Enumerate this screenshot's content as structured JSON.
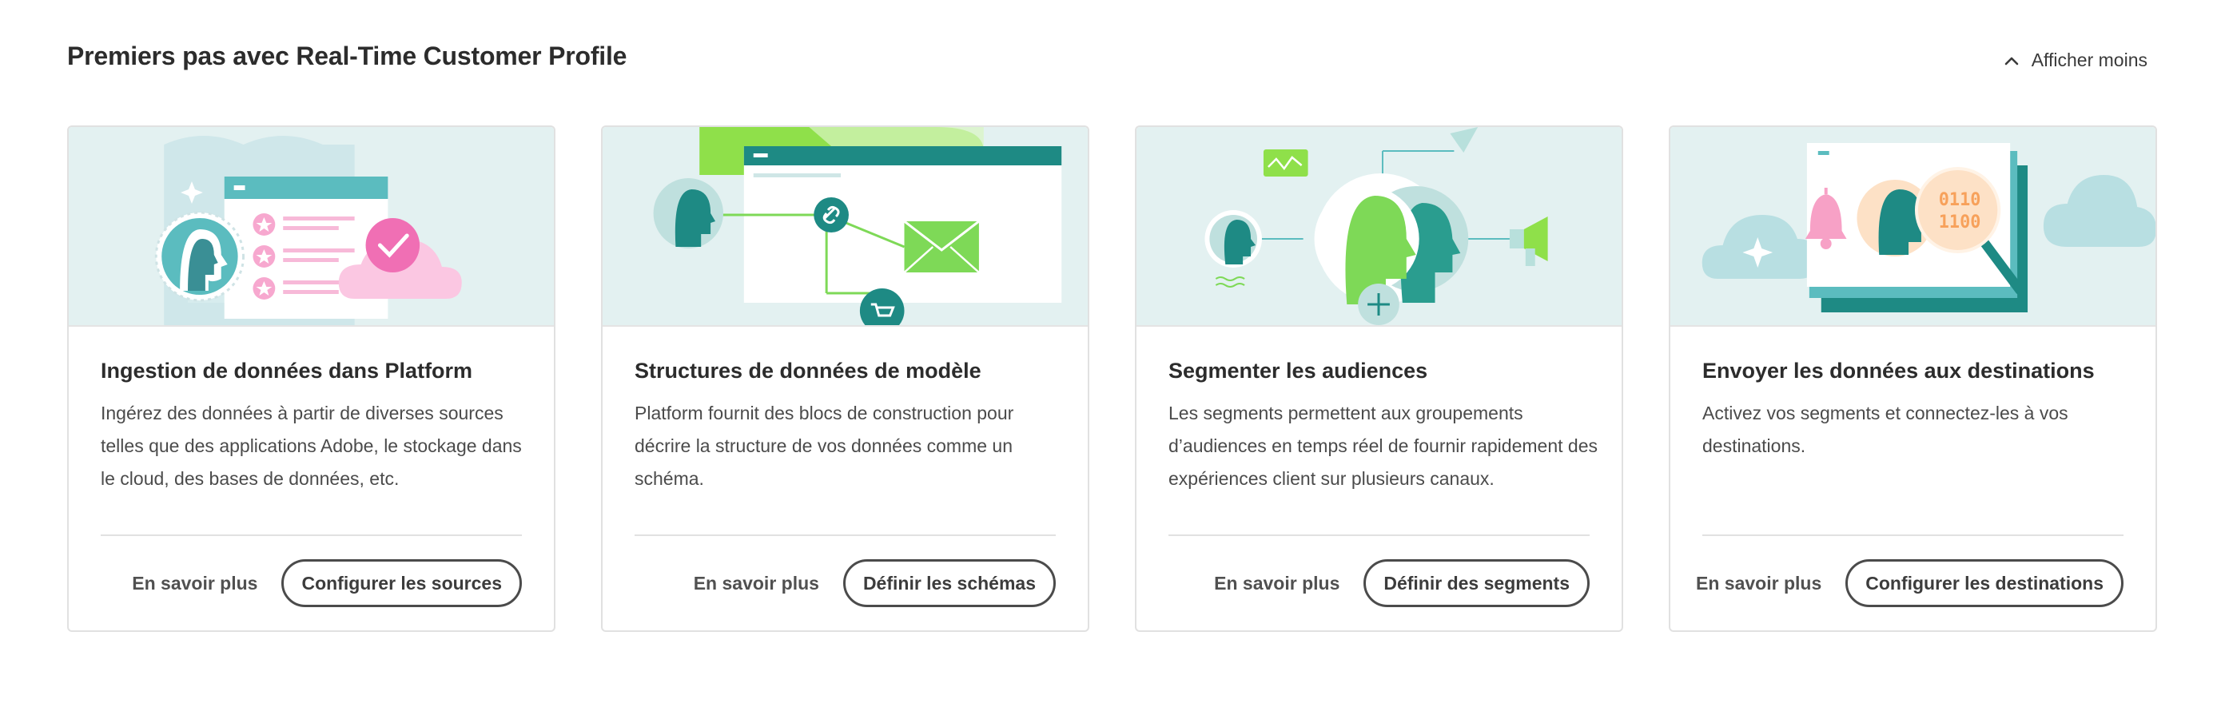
{
  "header": {
    "title": "Premiers pas avec Real-Time Customer Profile",
    "toggle_label": "Afficher moins"
  },
  "colors": {
    "illustration_bg": "#e3f1f1",
    "teal": "#2a9d8f",
    "green": "#7ed957",
    "pink": "#f06fb4",
    "orange": "#f7a15b"
  },
  "cards": [
    {
      "title": "Ingestion de données dans Platform",
      "description": "Ingérez des données à partir de diverses sources telles que des applications Adobe, le stockage dans le cloud, des bases de données, etc.",
      "secondary_action": "En savoir plus",
      "primary_action": "Configurer les sources"
    },
    {
      "title": "Structures de données de modèle",
      "description": "Platform fournit des blocs de construction pour décrire la structure de vos données comme un schéma.",
      "secondary_action": "En savoir plus",
      "primary_action": "Définir les schémas"
    },
    {
      "title": "Segmenter les audiences",
      "description": "Les segments permettent aux groupements d’audiences en temps réel de fournir rapidement des expériences client sur plusieurs canaux.",
      "secondary_action": "En savoir plus",
      "primary_action": "Définir des segments"
    },
    {
      "title": "Envoyer les données aux destinations",
      "description": "Activez vos segments et connectez-les à vos destinations.",
      "secondary_action": "En savoir plus",
      "primary_action": "Configurer les destinations"
    }
  ],
  "illustration_glyphs": {
    "binary_top": "0110",
    "binary_bottom": "1100"
  }
}
